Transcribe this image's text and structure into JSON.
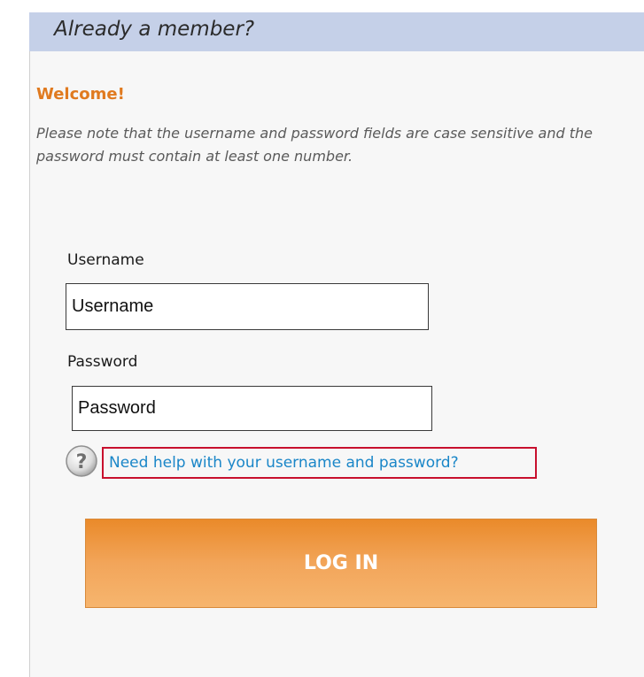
{
  "header": {
    "title": "Already a member?"
  },
  "form": {
    "welcome": "Welcome!",
    "note": "Please note that the username and password fields are case sensitive and the password must contain at least one number.",
    "username_label": "Username",
    "username_value": "Username",
    "password_label": "Password",
    "password_value": "Password",
    "help_link": "Need help with your username and password?",
    "help_icon_glyph": "?",
    "login_button": "LOG IN"
  },
  "colors": {
    "header_bg": "#c5d0e8",
    "welcome": "#e07a1f",
    "link": "#1a86c8",
    "highlight_border": "#c8102e",
    "button_top": "#ea8a2a",
    "button_bottom": "#f6b56e"
  },
  "icons": {
    "help": "question-mark-circle-icon"
  }
}
